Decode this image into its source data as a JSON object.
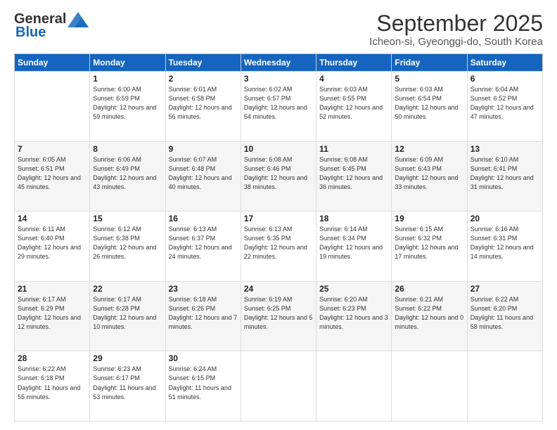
{
  "logo": {
    "line1": "General",
    "line2": "Blue"
  },
  "title": "September 2025",
  "location": "Icheon-si, Gyeonggi-do, South Korea",
  "days_of_week": [
    "Sunday",
    "Monday",
    "Tuesday",
    "Wednesday",
    "Thursday",
    "Friday",
    "Saturday"
  ],
  "weeks": [
    [
      {
        "num": "",
        "sunrise": "",
        "sunset": "",
        "daylight": ""
      },
      {
        "num": "1",
        "sunrise": "Sunrise: 6:00 AM",
        "sunset": "Sunset: 6:59 PM",
        "daylight": "Daylight: 12 hours and 59 minutes."
      },
      {
        "num": "2",
        "sunrise": "Sunrise: 6:01 AM",
        "sunset": "Sunset: 6:58 PM",
        "daylight": "Daylight: 12 hours and 56 minutes."
      },
      {
        "num": "3",
        "sunrise": "Sunrise: 6:02 AM",
        "sunset": "Sunset: 6:57 PM",
        "daylight": "Daylight: 12 hours and 54 minutes."
      },
      {
        "num": "4",
        "sunrise": "Sunrise: 6:03 AM",
        "sunset": "Sunset: 6:55 PM",
        "daylight": "Daylight: 12 hours and 52 minutes."
      },
      {
        "num": "5",
        "sunrise": "Sunrise: 6:03 AM",
        "sunset": "Sunset: 6:54 PM",
        "daylight": "Daylight: 12 hours and 50 minutes."
      },
      {
        "num": "6",
        "sunrise": "Sunrise: 6:04 AM",
        "sunset": "Sunset: 6:52 PM",
        "daylight": "Daylight: 12 hours and 47 minutes."
      }
    ],
    [
      {
        "num": "7",
        "sunrise": "Sunrise: 6:05 AM",
        "sunset": "Sunset: 6:51 PM",
        "daylight": "Daylight: 12 hours and 45 minutes."
      },
      {
        "num": "8",
        "sunrise": "Sunrise: 6:06 AM",
        "sunset": "Sunset: 6:49 PM",
        "daylight": "Daylight: 12 hours and 43 minutes."
      },
      {
        "num": "9",
        "sunrise": "Sunrise: 6:07 AM",
        "sunset": "Sunset: 6:48 PM",
        "daylight": "Daylight: 12 hours and 40 minutes."
      },
      {
        "num": "10",
        "sunrise": "Sunrise: 6:08 AM",
        "sunset": "Sunset: 6:46 PM",
        "daylight": "Daylight: 12 hours and 38 minutes."
      },
      {
        "num": "11",
        "sunrise": "Sunrise: 6:08 AM",
        "sunset": "Sunset: 6:45 PM",
        "daylight": "Daylight: 12 hours and 36 minutes."
      },
      {
        "num": "12",
        "sunrise": "Sunrise: 6:09 AM",
        "sunset": "Sunset: 6:43 PM",
        "daylight": "Daylight: 12 hours and 33 minutes."
      },
      {
        "num": "13",
        "sunrise": "Sunrise: 6:10 AM",
        "sunset": "Sunset: 6:41 PM",
        "daylight": "Daylight: 12 hours and 31 minutes."
      }
    ],
    [
      {
        "num": "14",
        "sunrise": "Sunrise: 6:11 AM",
        "sunset": "Sunset: 6:40 PM",
        "daylight": "Daylight: 12 hours and 29 minutes."
      },
      {
        "num": "15",
        "sunrise": "Sunrise: 6:12 AM",
        "sunset": "Sunset: 6:38 PM",
        "daylight": "Daylight: 12 hours and 26 minutes."
      },
      {
        "num": "16",
        "sunrise": "Sunrise: 6:13 AM",
        "sunset": "Sunset: 6:37 PM",
        "daylight": "Daylight: 12 hours and 24 minutes."
      },
      {
        "num": "17",
        "sunrise": "Sunrise: 6:13 AM",
        "sunset": "Sunset: 6:35 PM",
        "daylight": "Daylight: 12 hours and 22 minutes."
      },
      {
        "num": "18",
        "sunrise": "Sunrise: 6:14 AM",
        "sunset": "Sunset: 6:34 PM",
        "daylight": "Daylight: 12 hours and 19 minutes."
      },
      {
        "num": "19",
        "sunrise": "Sunrise: 6:15 AM",
        "sunset": "Sunset: 6:32 PM",
        "daylight": "Daylight: 12 hours and 17 minutes."
      },
      {
        "num": "20",
        "sunrise": "Sunrise: 6:16 AM",
        "sunset": "Sunset: 6:31 PM",
        "daylight": "Daylight: 12 hours and 14 minutes."
      }
    ],
    [
      {
        "num": "21",
        "sunrise": "Sunrise: 6:17 AM",
        "sunset": "Sunset: 6:29 PM",
        "daylight": "Daylight: 12 hours and 12 minutes."
      },
      {
        "num": "22",
        "sunrise": "Sunrise: 6:17 AM",
        "sunset": "Sunset: 6:28 PM",
        "daylight": "Daylight: 12 hours and 10 minutes."
      },
      {
        "num": "23",
        "sunrise": "Sunrise: 6:18 AM",
        "sunset": "Sunset: 6:26 PM",
        "daylight": "Daylight: 12 hours and 7 minutes."
      },
      {
        "num": "24",
        "sunrise": "Sunrise: 6:19 AM",
        "sunset": "Sunset: 6:25 PM",
        "daylight": "Daylight: 12 hours and 5 minutes."
      },
      {
        "num": "25",
        "sunrise": "Sunrise: 6:20 AM",
        "sunset": "Sunset: 6:23 PM",
        "daylight": "Daylight: 12 hours and 3 minutes."
      },
      {
        "num": "26",
        "sunrise": "Sunrise: 6:21 AM",
        "sunset": "Sunset: 6:22 PM",
        "daylight": "Daylight: 12 hours and 0 minutes."
      },
      {
        "num": "27",
        "sunrise": "Sunrise: 6:22 AM",
        "sunset": "Sunset: 6:20 PM",
        "daylight": "Daylight: 11 hours and 58 minutes."
      }
    ],
    [
      {
        "num": "28",
        "sunrise": "Sunrise: 6:22 AM",
        "sunset": "Sunset: 6:18 PM",
        "daylight": "Daylight: 11 hours and 55 minutes."
      },
      {
        "num": "29",
        "sunrise": "Sunrise: 6:23 AM",
        "sunset": "Sunset: 6:17 PM",
        "daylight": "Daylight: 11 hours and 53 minutes."
      },
      {
        "num": "30",
        "sunrise": "Sunrise: 6:24 AM",
        "sunset": "Sunset: 6:15 PM",
        "daylight": "Daylight: 11 hours and 51 minutes."
      },
      {
        "num": "",
        "sunrise": "",
        "sunset": "",
        "daylight": ""
      },
      {
        "num": "",
        "sunrise": "",
        "sunset": "",
        "daylight": ""
      },
      {
        "num": "",
        "sunrise": "",
        "sunset": "",
        "daylight": ""
      },
      {
        "num": "",
        "sunrise": "",
        "sunset": "",
        "daylight": ""
      }
    ]
  ]
}
